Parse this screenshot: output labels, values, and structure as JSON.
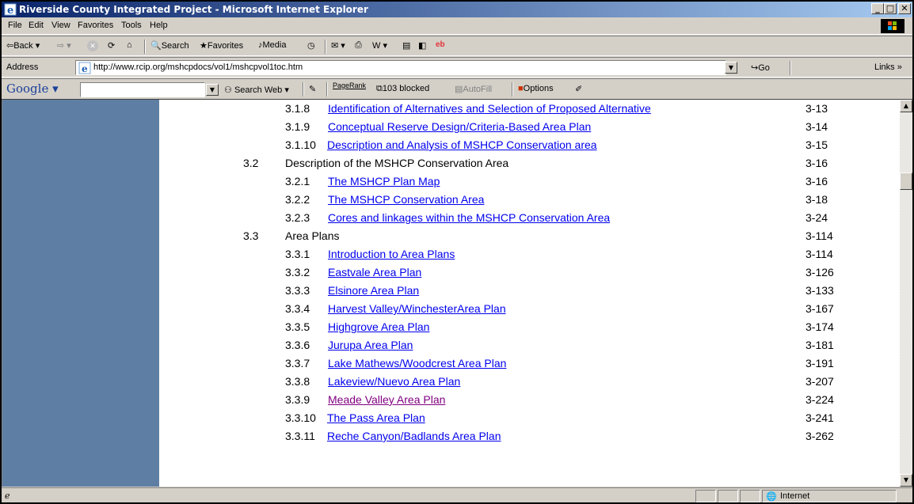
{
  "window": {
    "title": "Riverside County Integrated Project - Microsoft Internet Explorer"
  },
  "menu": [
    "File",
    "Edit",
    "View",
    "Favorites",
    "Tools",
    "Help"
  ],
  "toolbar": {
    "back": "Back",
    "search": "Search",
    "favorites": "Favorites",
    "media": "Media"
  },
  "address": {
    "label": "Address",
    "url": "http://www.rcip.org/mshcpdocs/vol1/mshcpvol1toc.htm",
    "go": "Go",
    "links": "Links"
  },
  "google": {
    "logo": "Google",
    "search_value": "",
    "search_web": "Search Web",
    "pagerank": "PageRank",
    "blocked": "103 blocked",
    "autofill": "AutoFill",
    "options": "Options"
  },
  "toc": [
    {
      "num": "3.1.8",
      "title": "Identification of Alternatives and Selection of Proposed Alternative",
      "page": "3-13",
      "link": true,
      "visited": false,
      "level": 3
    },
    {
      "num": "3.1.9",
      "title": "Conceptual Reserve Design/Criteria-Based Area Plan",
      "page": "3-14",
      "link": true,
      "visited": false,
      "level": 3
    },
    {
      "num": "3.1.10",
      "title": "Description and Analysis of MSHCP Conservation area",
      "page": "3-15",
      "link": true,
      "visited": false,
      "level": 3
    },
    {
      "num": "3.2",
      "title": "Description of the MSHCP Conservation Area",
      "page": "3-16",
      "link": false,
      "visited": false,
      "level": 2
    },
    {
      "num": "3.2.1",
      "title": "The MSHCP Plan Map",
      "page": "3-16",
      "link": true,
      "visited": false,
      "level": 3
    },
    {
      "num": "3.2.2",
      "title": "The MSHCP Conservation Area",
      "page": "3-18",
      "link": true,
      "visited": false,
      "level": 3
    },
    {
      "num": "3.2.3",
      "title": "Cores and linkages within the MSHCP Conservation Area",
      "page": "3-24",
      "link": true,
      "visited": false,
      "level": 3
    },
    {
      "num": "3.3",
      "title": "Area Plans",
      "page": "3-114",
      "link": false,
      "visited": false,
      "level": 2
    },
    {
      "num": "3.3.1",
      "title": "Introduction to Area Plans",
      "page": "3-114",
      "link": true,
      "visited": false,
      "level": 3
    },
    {
      "num": "3.3.2",
      "title": "Eastvale Area Plan",
      "page": "3-126",
      "link": true,
      "visited": false,
      "level": 3
    },
    {
      "num": "3.3.3",
      "title": "Elsinore Area Plan",
      "page": "3-133",
      "link": true,
      "visited": false,
      "level": 3
    },
    {
      "num": "3.3.4",
      "title": "Harvest Valley/WinchesterArea Plan",
      "page": "3-167",
      "link": true,
      "visited": false,
      "level": 3
    },
    {
      "num": "3.3.5",
      "title": "Highgrove Area Plan",
      "page": "3-174",
      "link": true,
      "visited": false,
      "level": 3
    },
    {
      "num": "3.3.6",
      "title": "Jurupa Area Plan",
      "page": "3-181",
      "link": true,
      "visited": false,
      "level": 3
    },
    {
      "num": "3.3.7",
      "title": "Lake Mathews/Woodcrest Area Plan",
      "page": "3-191",
      "link": true,
      "visited": false,
      "level": 3
    },
    {
      "num": "3.3.8",
      "title": "Lakeview/Nuevo Area Plan",
      "page": "3-207",
      "link": true,
      "visited": false,
      "level": 3
    },
    {
      "num": "3.3.9",
      "title": "Meade Valley Area Plan",
      "page": "3-224",
      "link": true,
      "visited": true,
      "level": 3
    },
    {
      "num": "3.3.10",
      "title": "The Pass Area Plan",
      "page": "3-241",
      "link": true,
      "visited": false,
      "level": 3
    },
    {
      "num": "3.3.11",
      "title": "Reche Canyon/Badlands Area Plan",
      "page": "3-262",
      "link": true,
      "visited": false,
      "level": 3
    }
  ],
  "status": {
    "zone": "Internet"
  },
  "colors": {
    "title_start": "#0a246a",
    "title_end": "#a6caf0",
    "left_panel": "#5e7fa3",
    "link": "#0000ee",
    "visited": "#800080"
  }
}
